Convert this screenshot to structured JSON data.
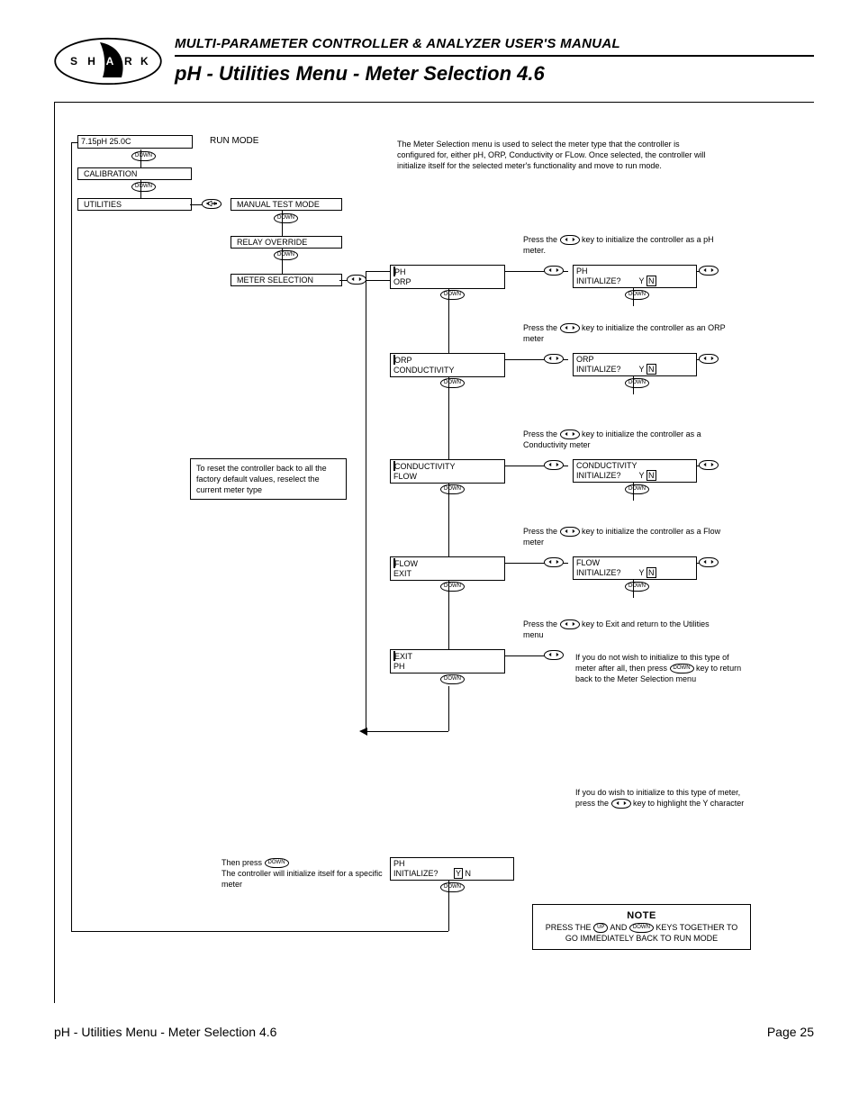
{
  "logo_letters": [
    "S",
    "H",
    "A",
    "R",
    "K"
  ],
  "manual_title": "MULTI-PARAMETER CONTROLLER & ANALYZER USER'S MANUAL",
  "page_title": "pH - Utilities Menu - Meter Selection 4.6",
  "run_mode_label": "RUN MODE",
  "intro_para": "The Meter Selection menu is used to select the meter type that the controller is configured for, either pH, ORP, Conductivity or FLow. Once selected, the controller will initialize itself for the selected meter's functionality and move to run mode.",
  "left_nav": {
    "lcd_runmode": "7.15pH  25.0C",
    "calibration": "CALIBRATION",
    "utilities": "UTILITIES",
    "manual_test": "MANUAL TEST MODE",
    "relay_override": "RELAY OVERRIDE",
    "meter_selection": "METER SELECTION"
  },
  "reset_text": "To reset the controller back to all the factory default values, reselect the current meter type",
  "key_labels": {
    "down": "DOWN",
    "up": "UP"
  },
  "press_ph": "Press the     key to initialize the controller as a pH meter.",
  "press_orp": "Press the     key to initialize the controller as an ORP meter",
  "press_cond": "Press the     key to initialize the controller as a Conductivity meter",
  "press_flow": "Press the     key to initialize the controller as a Flow meter",
  "press_exit": "Press the     key to Exit and return to the Utilities menu",
  "no_init_para": "If you do not wish to initialize to this type of meter after all, then press     key to return back to the Meter Selection menu",
  "yes_init_para": "If you do wish to initialize to this type of meter, press the     key to highlight the Y character",
  "then_press_para": "Then press     The controller will initialize itself for a specific meter",
  "screens": {
    "ph": {
      "l1": "PH",
      "l2": "ORP",
      "cur_after": "P"
    },
    "orp": {
      "l1": "ORP",
      "l2": "CONDUCTIVITY",
      "cur_after": "O"
    },
    "cond": {
      "l1": "CONDUCTIVITY",
      "l2": "FLOW",
      "cur_after": "C"
    },
    "flow": {
      "l1": "FLOW",
      "l2": "EXIT",
      "cur_after": "F"
    },
    "exit": {
      "l1": "EXIT",
      "l2": "PH",
      "cur_after": "E"
    },
    "ph_init": {
      "l1": "PH",
      "l2": "INITIALIZE?          Y  N"
    },
    "orp_init": {
      "l1": "ORP",
      "l2": "INITIALIZE?          Y  N"
    },
    "cond_init": {
      "l1": "CONDUCTIVITY",
      "l2": "INITIALIZE?          Y  N"
    },
    "flow_init": {
      "l1": "FLOW",
      "l2": "INITIALIZE?          Y  N"
    },
    "final": {
      "l1": "PH",
      "l2": "INITIALIZE?          Y  N"
    }
  },
  "yn": {
    "y_boxed": "Y",
    "n_boxed": "N"
  },
  "note": {
    "title": "NOTE",
    "body_a": "PRESS THE ",
    "body_b": " AND ",
    "body_c": " KEYS TOGETHER TO GO IMMEDIATELY BACK TO RUN MODE"
  },
  "footer_left": "pH - Utilities Menu - Meter Selection 4.6",
  "footer_right": "Page 25"
}
